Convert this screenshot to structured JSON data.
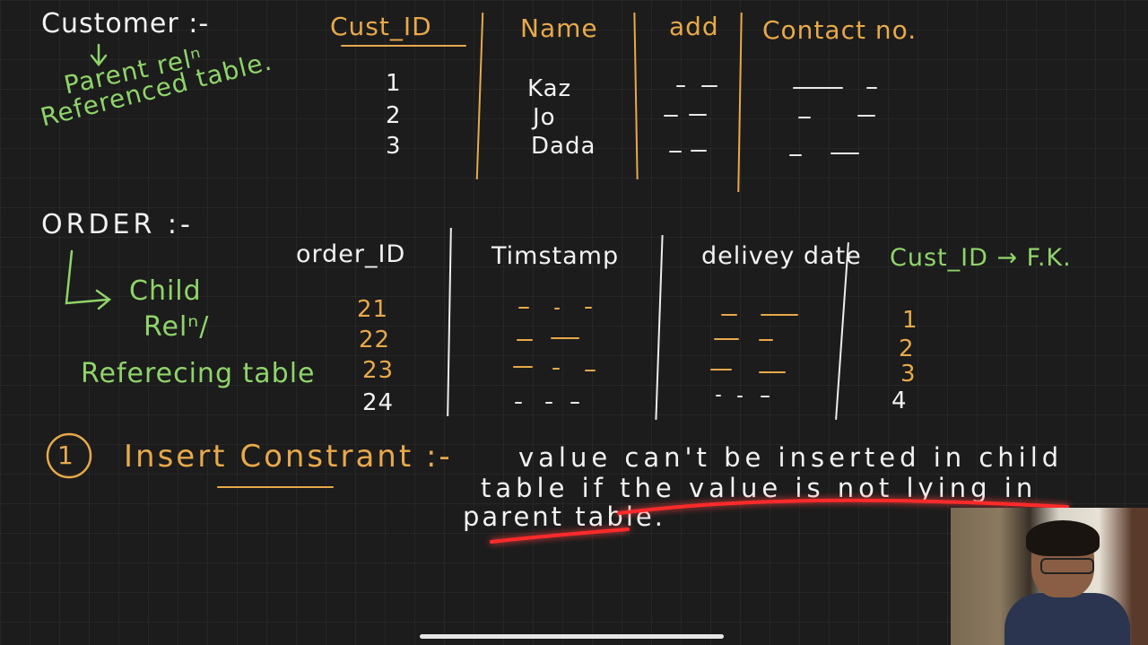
{
  "customer": {
    "title": "Customer :-",
    "note_parent": "Parent relⁿ",
    "note_referenced": "Referenced table.",
    "columns": [
      "Cust_ID",
      "Name",
      "add",
      "Contact no."
    ],
    "rows": [
      {
        "id": "1",
        "name": "Kaz"
      },
      {
        "id": "2",
        "name": "Jo"
      },
      {
        "id": "3",
        "name": "Dada"
      }
    ]
  },
  "order": {
    "title": "ORDER :-",
    "note_child": "Child",
    "note_reln": "Relⁿ/",
    "note_referencing": "Referecing table",
    "columns": [
      "order_ID",
      "Timstamp",
      "delivey date",
      "Cust_ID → F.K."
    ],
    "rows": [
      {
        "id": "21",
        "cust": "1"
      },
      {
        "id": "22",
        "cust": "2"
      },
      {
        "id": "23",
        "cust": "3"
      },
      {
        "id": "24",
        "cust": "4"
      }
    ]
  },
  "constraint": {
    "number": "1",
    "title": "Insert Constrant :-",
    "line1": "value can't be inserted in child",
    "line2": "table if the value is not lying in",
    "line3": "parent table."
  },
  "colors": {
    "background": "#1c1c1c",
    "ink_white": "#f2f2f2",
    "ink_orange": "#e8a94a",
    "ink_green": "#8fd46a",
    "laser_red": "#ff2a2a"
  },
  "icons": {
    "arrow": "hand-drawn-arrow-icon",
    "camera": "webcam-overlay"
  }
}
